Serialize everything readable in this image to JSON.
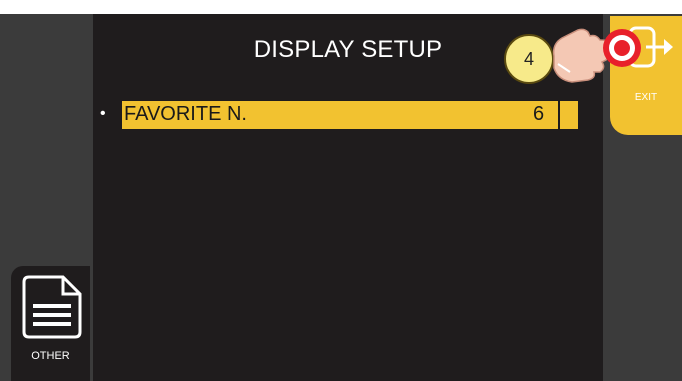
{
  "header": {
    "title": "DISPLAY SETUP"
  },
  "settings": {
    "rows": [
      {
        "bullet": "•",
        "label": "FAVORITE N.",
        "value": "6"
      }
    ]
  },
  "right_panel": {
    "exit_label": "EXIT",
    "exit_icon": "exit-icon"
  },
  "left_panel": {
    "other_label": "OTHER",
    "other_icon": "document-icon"
  },
  "tutorial": {
    "step_number": "4",
    "pointer_icon": "pointing-hand-icon"
  },
  "colors": {
    "accent": "#f2c230",
    "main_background": "#1f1c1d",
    "side_background": "#3b3b3b",
    "step_badge": "#f7ea8a",
    "touch_target": "#e8202a"
  }
}
